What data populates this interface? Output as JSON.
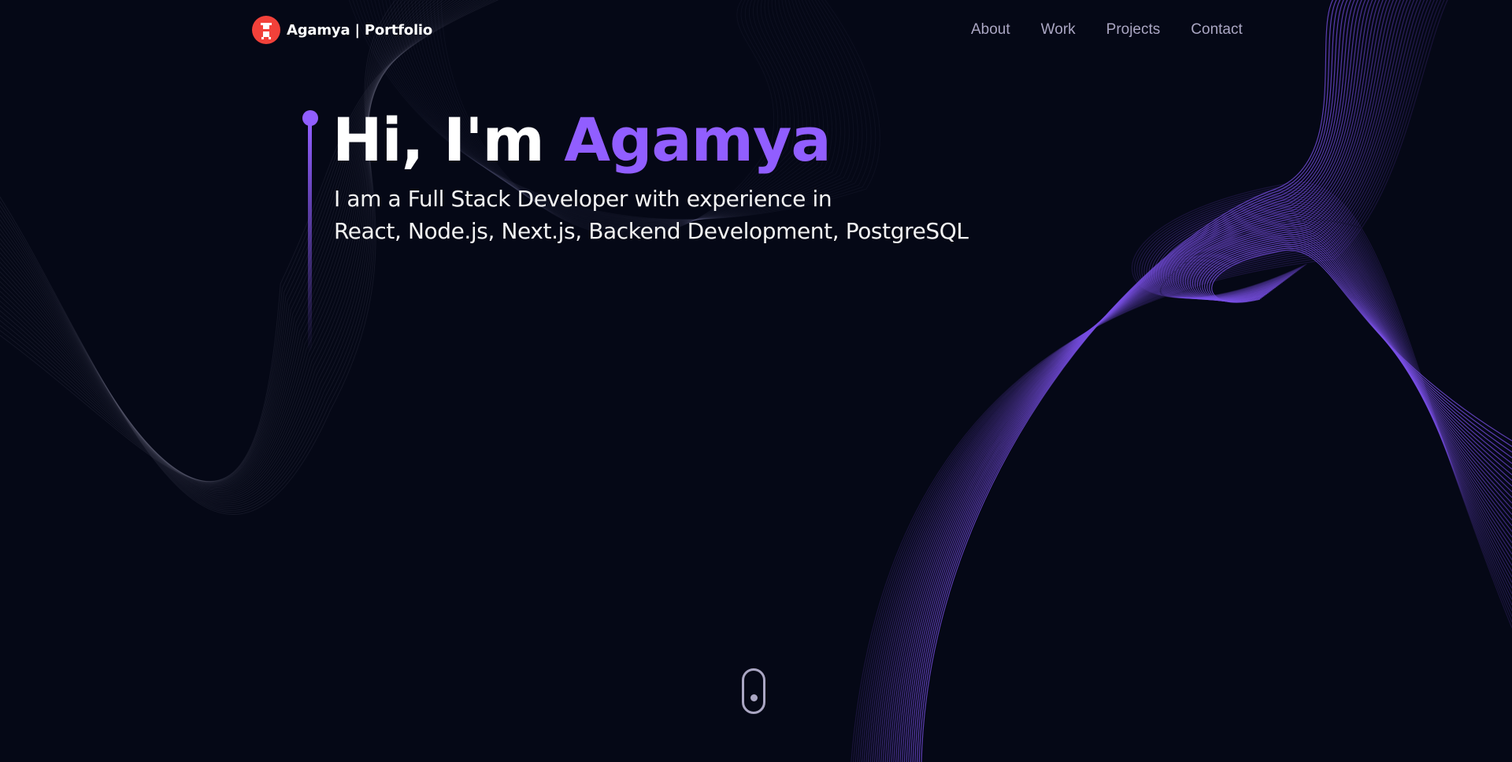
{
  "brand": {
    "logo": "A",
    "name": "Agamya",
    "separator": " | ",
    "suffix": "Portfolio",
    "logo_color": "#f2413a"
  },
  "nav": {
    "links": [
      {
        "label": "About"
      },
      {
        "label": "Work"
      },
      {
        "label": "Projects"
      },
      {
        "label": "Contact"
      }
    ]
  },
  "hero": {
    "greeting": "Hi, I'm ",
    "name": "Agamya",
    "subtitle_line1": "I am a Full Stack Developer with experience in",
    "subtitle_line2": "React, Node.js, Next.js, Backend Development, PostgreSQL"
  },
  "colors": {
    "background": "#050816",
    "accent": "#915eff",
    "nav_text": "#aaa6c3",
    "text": "#ffffff"
  },
  "icons": {
    "logo": "brand-logo-icon",
    "scroll": "scroll-down-icon"
  }
}
